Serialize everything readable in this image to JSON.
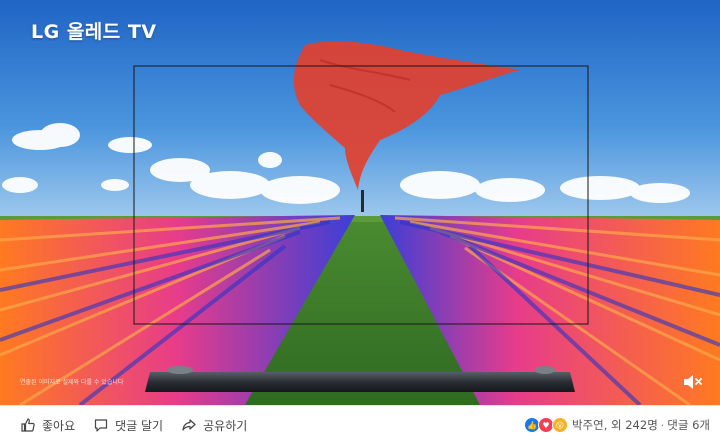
{
  "media": {
    "brand": "LG 올레드 TV",
    "disclaimer": "연출된 이미지로 실제와 다를 수 있습니다",
    "mute_icon": "speaker-muted-icon"
  },
  "actions": {
    "like_label": "좋아요",
    "comment_label": "댓글 달기",
    "share_label": "공유하기"
  },
  "reactions": {
    "icons": [
      "like",
      "love",
      "wow"
    ],
    "summary": "박주연, 외 242명",
    "separator": "·",
    "comments": "댓글 6개"
  },
  "colors": {
    "like": "#1877f2",
    "love": "#f33e58",
    "wow": "#f7b125"
  }
}
